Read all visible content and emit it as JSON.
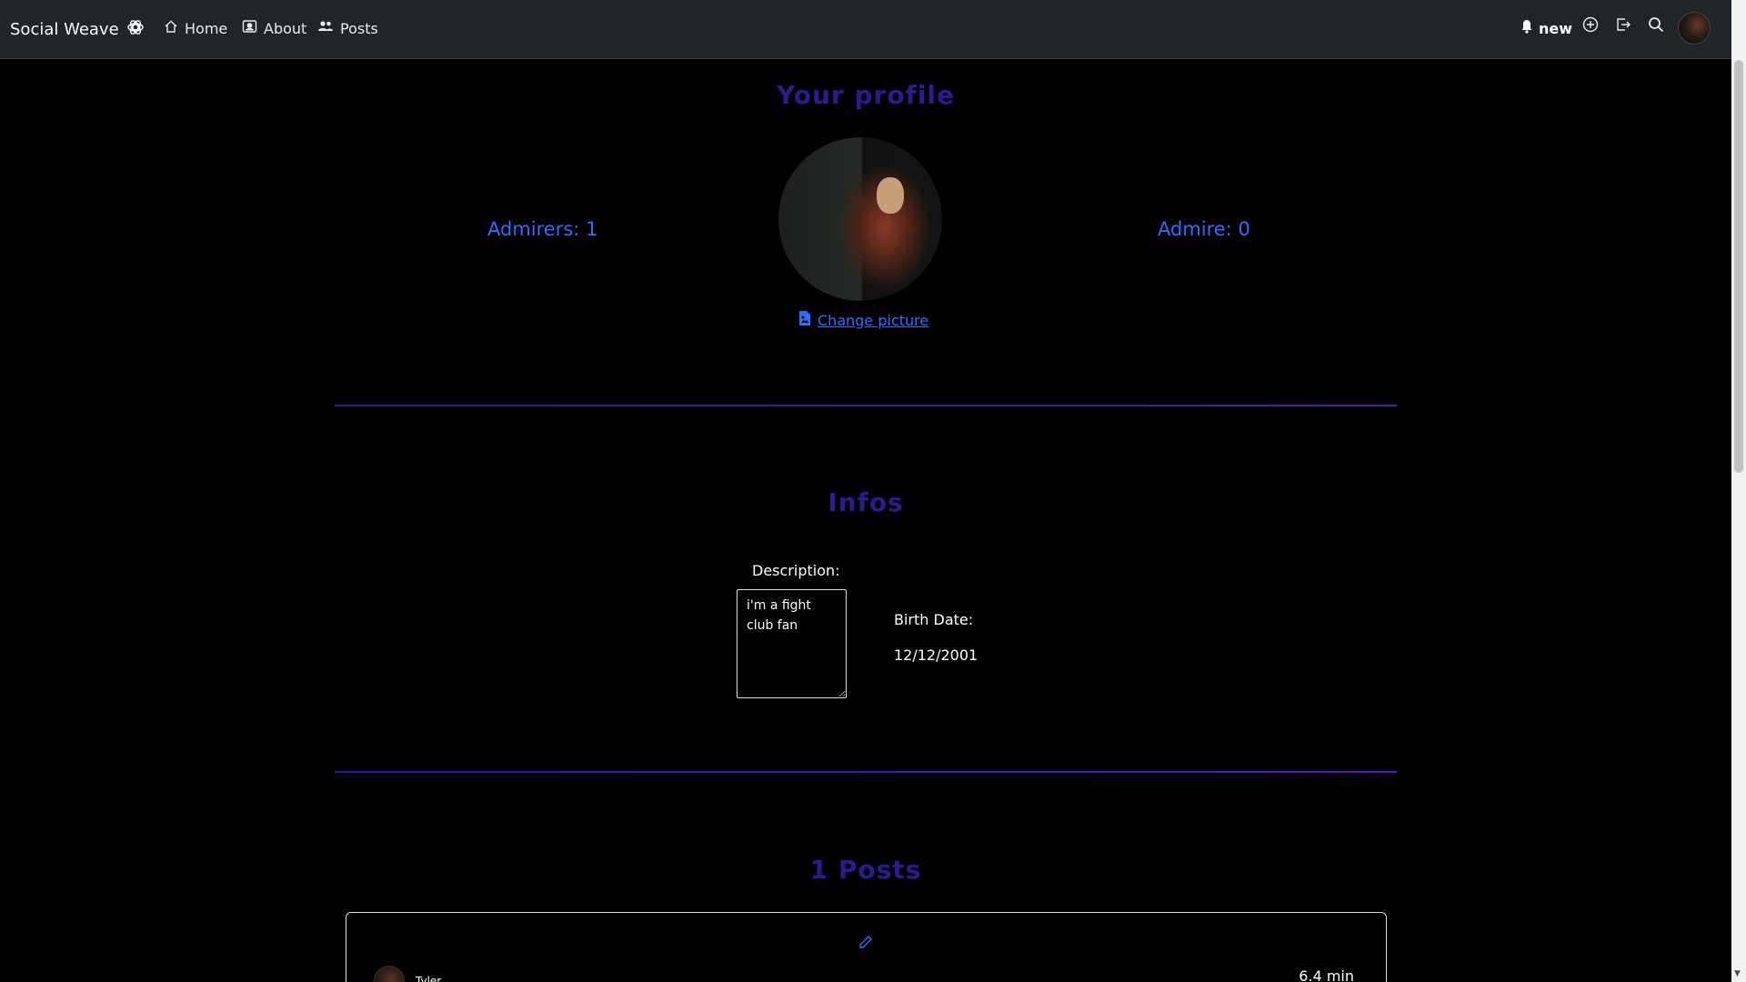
{
  "navbar": {
    "brand": "Social Weave",
    "links": [
      {
        "label": "Home",
        "icon": "home-icon"
      },
      {
        "label": "About",
        "icon": "id-card-icon"
      },
      {
        "label": "Posts",
        "icon": "people-icon"
      }
    ],
    "notifications_label": "new",
    "right_icons": [
      "bell-icon",
      "plus-circle-icon",
      "logout-icon",
      "search-icon"
    ]
  },
  "profile": {
    "title": "Your profile",
    "admirers": "Admirers: 1",
    "admire": "Admire: 0",
    "change_picture": "Change picture"
  },
  "infos": {
    "title": "Infos",
    "description_label": "Description:",
    "description_value": "i'm a fight club fan",
    "birth_date_label": "Birth Date:",
    "birth_date_value": "12/12/2001"
  },
  "posts": {
    "title": "1 Posts",
    "items": [
      {
        "author": "Tyler",
        "time": "6.4 min"
      }
    ]
  },
  "colors": {
    "accent_blue": "#2f6bff",
    "title_purple": "#2d1a8e",
    "navbar_bg": "#212529",
    "page_bg": "#000000"
  }
}
